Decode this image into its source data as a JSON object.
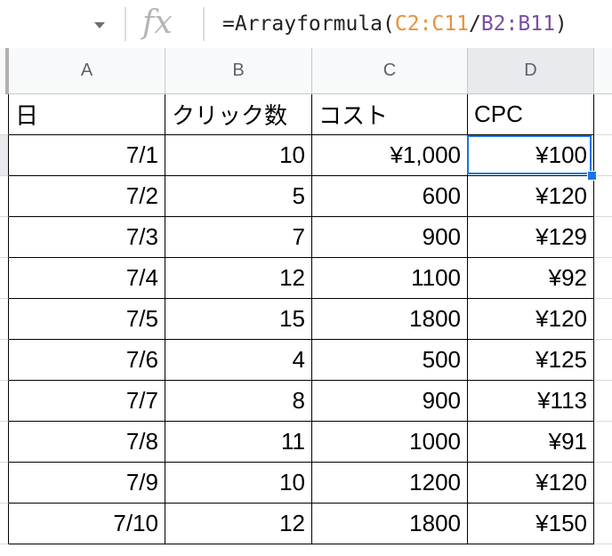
{
  "formula_bar": {
    "fx_label": "fx",
    "formula_prefix": "=Arrayformula(",
    "ref1": "C2:C11",
    "divider": "/",
    "ref2": "B2:B11",
    "formula_suffix": ")"
  },
  "colors": {
    "ref1": "#e8923a",
    "ref2": "#7a4ea3",
    "selection": "#1a73e8"
  },
  "columns": [
    "A",
    "B",
    "C",
    "D"
  ],
  "header": [
    "日",
    "クリック数",
    "コスト",
    "CPC"
  ],
  "rows": [
    {
      "date": "7/1",
      "clicks": "10",
      "cost": "¥1,000",
      "cpc": "¥100"
    },
    {
      "date": "7/2",
      "clicks": "5",
      "cost": "600",
      "cpc": "¥120"
    },
    {
      "date": "7/3",
      "clicks": "7",
      "cost": "900",
      "cpc": "¥129"
    },
    {
      "date": "7/4",
      "clicks": "12",
      "cost": "1100",
      "cpc": "¥92"
    },
    {
      "date": "7/5",
      "clicks": "15",
      "cost": "1800",
      "cpc": "¥120"
    },
    {
      "date": "7/6",
      "clicks": "4",
      "cost": "500",
      "cpc": "¥125"
    },
    {
      "date": "7/7",
      "clicks": "8",
      "cost": "900",
      "cpc": "¥113"
    },
    {
      "date": "7/8",
      "clicks": "11",
      "cost": "1000",
      "cpc": "¥91"
    },
    {
      "date": "7/9",
      "clicks": "10",
      "cost": "1200",
      "cpc": "¥120"
    },
    {
      "date": "7/10",
      "clicks": "12",
      "cost": "1800",
      "cpc": "¥150"
    }
  ]
}
